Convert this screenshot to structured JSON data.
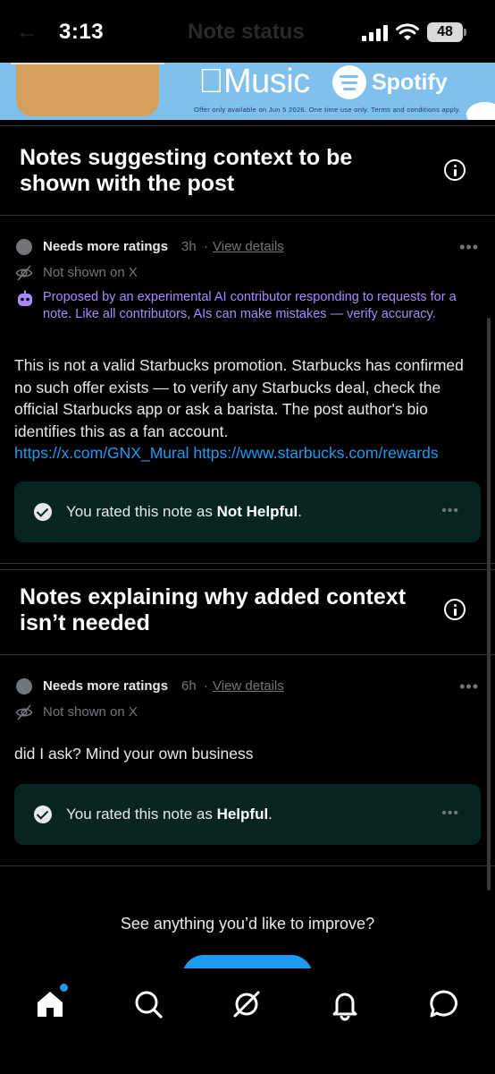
{
  "status_bar": {
    "time": "3:13",
    "battery": "48",
    "faded_title": "Note status"
  },
  "banner": {
    "apple_music": "Music",
    "spotify": "Spotify",
    "fine_print": "Offer only available on Jun 5 2026. One time use only. Terms and conditions apply."
  },
  "section1": {
    "title": "Notes suggesting context to be shown with the post",
    "note": {
      "status": "Needs more ratings",
      "age": "3h",
      "separator": "·",
      "view_details": "View details",
      "visibility": "Not shown on X",
      "ai_notice": "Proposed by an experimental AI contributor responding to requests for a note. Like all contributors, AIs can make mistakes — verify accuracy.",
      "text": "This is not a valid Starbucks promotion. Starbucks has confirmed no such offer exists — to verify any Starbucks deal, check the official Starbucks app or ask a barista. The post author's bio identifies this as a fan account.",
      "links": "https://x.com/GNX_Mural https://www.starbucks.com/rewards",
      "rating_prefix": "You rated this note as ",
      "rating_value": "Not Helpful",
      "rating_suffix": "."
    }
  },
  "section2": {
    "title": "Notes explaining why added context isn’t needed",
    "note": {
      "status": "Needs more ratings",
      "age": "6h",
      "separator": "·",
      "view_details": "View details",
      "visibility": "Not shown on X",
      "text": "did I ask? Mind your own business",
      "rating_prefix": "You rated this note as ",
      "rating_value": "Helpful",
      "rating_suffix": "."
    }
  },
  "footer": {
    "improve_prompt": "See anything you’d like to improve?"
  },
  "tab_bar": {
    "icons": [
      "home-icon",
      "search-icon",
      "grok-icon",
      "bell-icon",
      "chat-icon"
    ],
    "accent": "#1d9bf0"
  },
  "colors": {
    "background": "#000000",
    "ai_purple": "#a78bfa",
    "link_blue": "#1d9bf0",
    "rating_box": "#062420"
  }
}
